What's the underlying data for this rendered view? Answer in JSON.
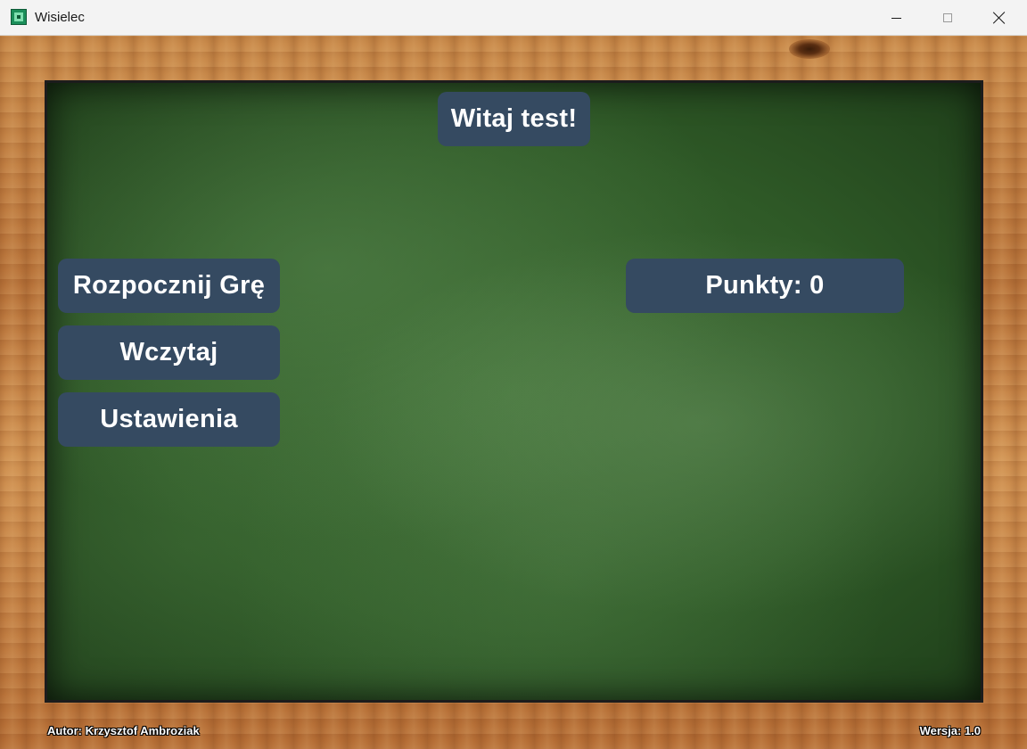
{
  "window": {
    "title": "Wisielec",
    "icon": "hangman-app-icon"
  },
  "controls": {
    "minimize": "minimize-icon",
    "maximize": "maximize-icon",
    "close": "close-icon"
  },
  "main": {
    "greeting": "Witaj test!",
    "menu": {
      "start_label": "Rozpocznij Grę",
      "load_label": "Wczytaj",
      "settings_label": "Ustawienia"
    },
    "points_label": "Punkty: 0"
  },
  "footer": {
    "author": "Autor: Krzysztof Ambroziak",
    "version": "Wersja: 1.0"
  },
  "colors": {
    "button_bg": "#354a61",
    "board_green": "#2f5a27",
    "frame_wood": "#b8733a"
  }
}
